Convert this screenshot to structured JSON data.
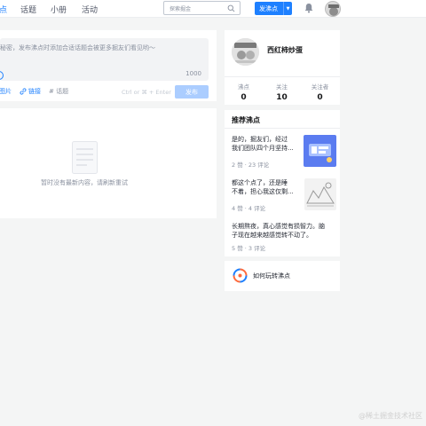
{
  "nav": {
    "items": [
      {
        "label": "点",
        "active": true
      },
      {
        "label": "话题",
        "active": false
      },
      {
        "label": "小册",
        "active": false
      },
      {
        "label": "活动",
        "active": false
      }
    ]
  },
  "search": {
    "placeholder": "探索掘金",
    "icon": "search-icon"
  },
  "header": {
    "publish_label": "发沸点",
    "bell_icon": "bell-icon"
  },
  "editor": {
    "placeholder": "秘密，发布沸点时添加合适话题会被更多掘友们看见哟～",
    "count": "1000",
    "tools": {
      "image": "图片",
      "link": "链接",
      "topic": "# 话题"
    },
    "shortcut": "Ctrl or ⌘ + Enter",
    "submit": "发布"
  },
  "feed": {
    "empty_text": "暂时没有最新内容，请刷新重试"
  },
  "profile": {
    "name": "西红柿炒蛋",
    "stats": [
      {
        "label": "沸点",
        "value": "0"
      },
      {
        "label": "关注",
        "value": "10"
      },
      {
        "label": "关注者",
        "value": "0"
      }
    ]
  },
  "recommend": {
    "title": "推荐沸点",
    "items": [
      {
        "line1": "是的，掘友们，经过",
        "line2": "我们团队四个月坚持...",
        "meta": "2 赞 · 23 评论"
      },
      {
        "line1": "都这个点了，还是睡",
        "line2": "不着，担心我这仅剩...",
        "meta": "4 赞 · 4 评论"
      },
      {
        "line1": "长期熬夜，真心感觉有损智力。脑",
        "line2": "子现在越来越感觉转不动了。",
        "meta": "5 赞 · 3 评论"
      }
    ]
  },
  "howto": {
    "label": "如何玩转沸点"
  },
  "watermark": "@稀土掘金技术社区",
  "colors": {
    "accent": "#1e80ff",
    "background": "#f4f5f5"
  }
}
